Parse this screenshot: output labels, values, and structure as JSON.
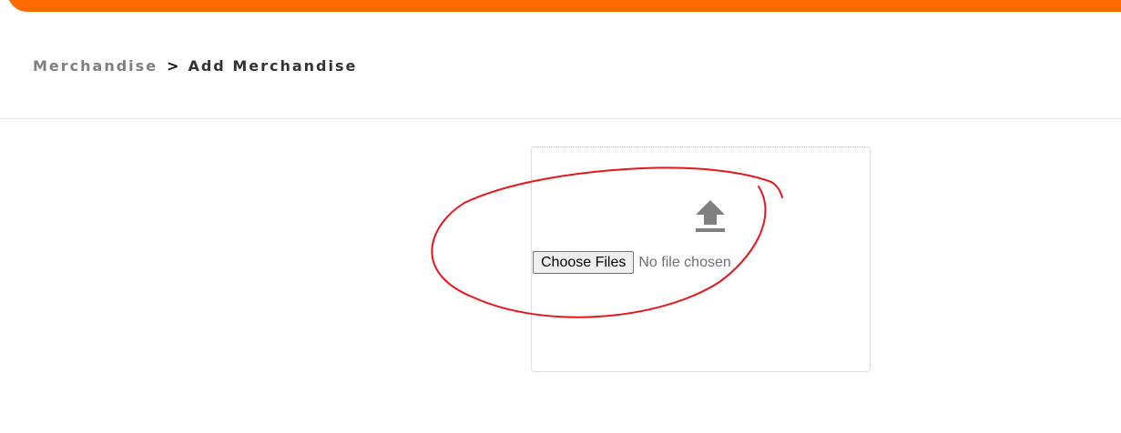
{
  "breadcrumb": {
    "parent": "Merchandise",
    "separator": ">",
    "current": "Add Merchandise"
  },
  "upload": {
    "icon": "upload-icon",
    "button_label": "Choose Files",
    "status_text": "No file chosen"
  },
  "colors": {
    "accent": "#ff6a00",
    "annotation": "#e8141b",
    "icon": "#808080"
  }
}
